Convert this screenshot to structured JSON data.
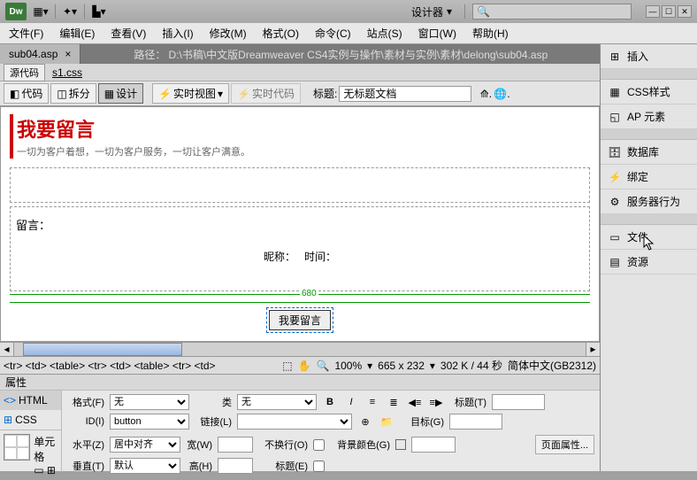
{
  "topbar": {
    "logo": "Dw",
    "designer_label": "设计器",
    "search_placeholder": ""
  },
  "menubar": {
    "items": [
      "文件(F)",
      "编辑(E)",
      "查看(V)",
      "插入(I)",
      "修改(M)",
      "格式(O)",
      "命令(C)",
      "站点(S)",
      "窗口(W)",
      "帮助(H)"
    ]
  },
  "file_tab": "sub04.asp",
  "path_label": "路径：",
  "path_value": "D:\\书稿\\中文版Dreamweaver CS4实例与操作\\素材与实例\\素材\\delong\\sub04.asp",
  "subtabs": {
    "source": "源代码",
    "css": "s1.css"
  },
  "toolbar": {
    "code": "代码",
    "split": "拆分",
    "design": "设计",
    "live_view": "实时视图",
    "live_code": "实时代码",
    "title_label": "标题:",
    "title_value": "无标题文档"
  },
  "design": {
    "banner_title": "我要留言",
    "banner_sub": "一切为客户着想，一切为客户服务，一切让客户满意。",
    "msg_label": "留言：",
    "nick_label": "昵称：",
    "time_label": "时间：",
    "ruler": "680",
    "submit": "我要留言"
  },
  "tagpath": "<tr> <td> <table> <tr> <td> <table> <tr> <td>",
  "status": {
    "zoom": "100%",
    "size": "665 x 232",
    "weight": "302 K / 44 秒",
    "encoding": "简体中文(GB2312)"
  },
  "props": {
    "header": "属性",
    "html_mode": "HTML",
    "css_mode": "CSS",
    "format_label": "格式(F)",
    "format_val": "无",
    "id_label": "ID(I)",
    "id_val": "button",
    "class_label": "类",
    "class_val": "无",
    "link_label": "链接(L)",
    "bold": "B",
    "italic": "I",
    "title_attr_label": "标题(T)",
    "target_label": "目标(G)",
    "cell_label": "单元格",
    "horiz_label": "水平(Z)",
    "horiz_val": "居中对齐",
    "vert_label": "垂直(T)",
    "vert_val": "默认",
    "width_label": "宽(W)",
    "height_label": "高(H)",
    "nowrap_label": "不换行(O)",
    "bg_label": "背景颜色(G)",
    "header_chk": "标题(E)",
    "page_props": "页面属性..."
  },
  "side": {
    "insert": "插入",
    "css_styles": "CSS样式",
    "ap_elements": "AP 元素",
    "database": "数据库",
    "bindings": "绑定",
    "server_behaviors": "服务器行为",
    "files": "文件",
    "assets": "资源"
  }
}
